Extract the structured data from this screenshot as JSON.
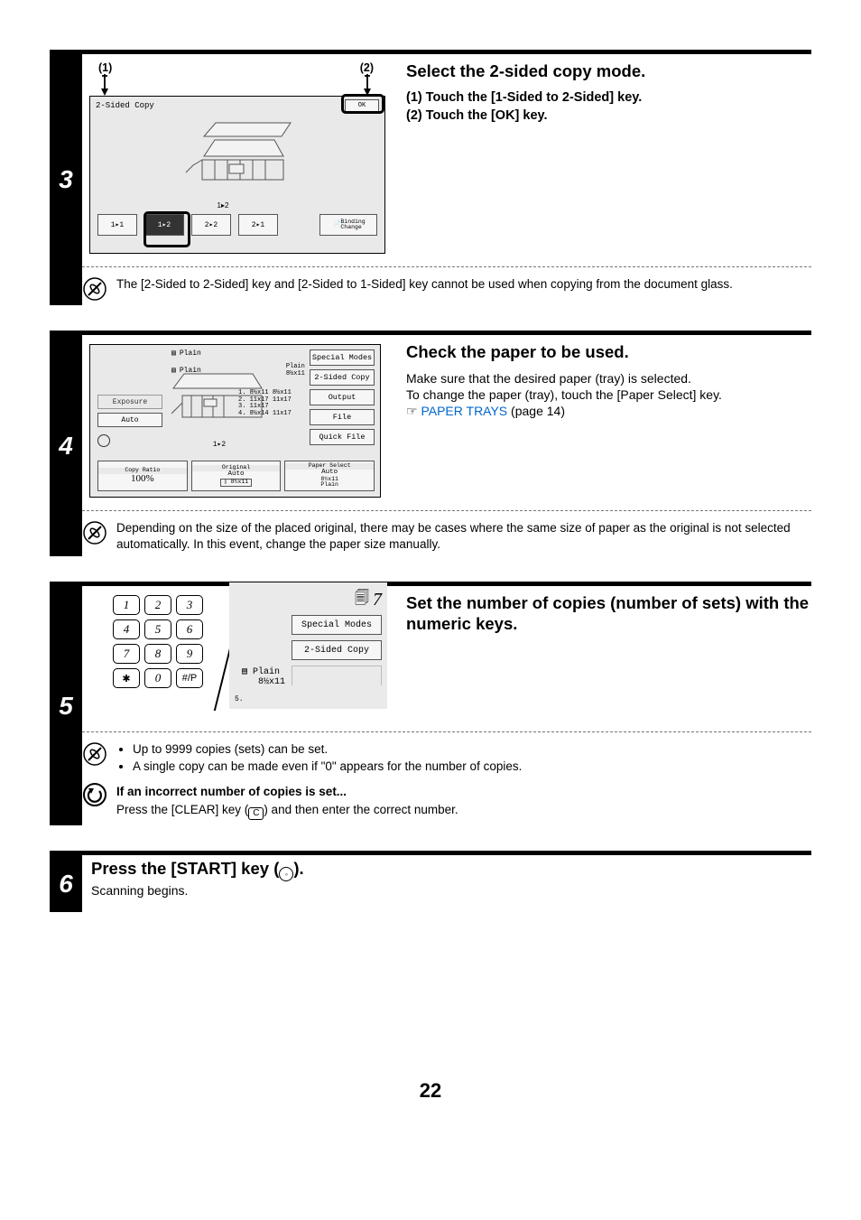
{
  "page_number": "22",
  "step3": {
    "num": "3",
    "callout1": "(1)",
    "callout2": "(2)",
    "heading": "Select the 2-sided copy mode.",
    "sub1": "(1)  Touch the [1-Sided to 2-Sided] key.",
    "sub2": "(2)  Touch the [OK] key.",
    "note": "The [2-Sided to 2-Sided] key and [2-Sided to 1-Sided] key cannot be used when copying from the document glass.",
    "screen": {
      "title": "2-Sided Copy",
      "ok": "OK",
      "modes": {
        "m1": "1▸1",
        "m2": "1▸2",
        "m3": "2▸2",
        "m4": "2▸1"
      },
      "binding_a": "Binding",
      "binding_b": "Change"
    }
  },
  "step4": {
    "num": "4",
    "heading": "Check the paper to be used.",
    "body1": "Make sure that the desired paper (tray) is selected.",
    "body2": "To change the paper (tray), touch the [Paper Select] key.",
    "pointer": "☞",
    "link": "PAPER TRAYS",
    "link_after": " (page 14)",
    "note": "Depending on the size of the placed original, there may be cases where the same size of paper as the original is not selected automatically. In this event, change the paper size manually.",
    "screen": {
      "plain": "Plain",
      "plain2": "Plain",
      "paperinfo": "8½x11",
      "rbtns": {
        "sm": "Special Modes",
        "tsc": "2-Sided Copy",
        "out": "Output",
        "file": "File",
        "qf": "Quick File"
      },
      "lbtns": {
        "exp": "Exposure",
        "auto": "Auto"
      },
      "trays": {
        "t1": "1. 8½x11",
        "t1b": "8½x11",
        "t2": "2. 11x17",
        "t2b": "11x17",
        "t3": "3. 11x17",
        "t4": "4. 8½x14",
        "t4b": "11x17"
      },
      "dup": "1▸2",
      "bbtns": {
        "cr_label": "Copy Ratio",
        "cr_val": "100%",
        "or_label": "Original",
        "or_val": "Auto",
        "or_sz": "8½x11",
        "ps_label": "Paper Select",
        "ps_val": "Auto",
        "ps_sz": "8½x11",
        "ps_plain": "Plain"
      }
    }
  },
  "step5": {
    "num": "5",
    "heading": "Set the number of copies (number of sets) with the numeric keys.",
    "bullets": {
      "b1": "Up to 9999 copies (sets) can be set.",
      "b2": "A single copy can be made even if \"0\" appears for the number of copies."
    },
    "subhead": "If an incorrect number of copies is set...",
    "subbody_a": "Press the [CLEAR] key (",
    "subbody_c": "C",
    "subbody_b": ") and then enter the correct number.",
    "keypad": {
      "k1": "1",
      "k2": "2",
      "k3": "3",
      "k4": "4",
      "k5": "5",
      "k6": "6",
      "k7": "7",
      "k8": "8",
      "k9": "9",
      "ks": "✱",
      "k0": "0",
      "kp": "#/P"
    },
    "screen": {
      "count": "7",
      "sm": "Special Modes",
      "tsc": "2-Sided Copy",
      "pp_plain": "Plain",
      "pp_size": "8½x11",
      "five": "5."
    }
  },
  "step6": {
    "num": "6",
    "heading_a": "Press the [START] key (",
    "heading_b": ").",
    "body": "Scanning begins."
  }
}
